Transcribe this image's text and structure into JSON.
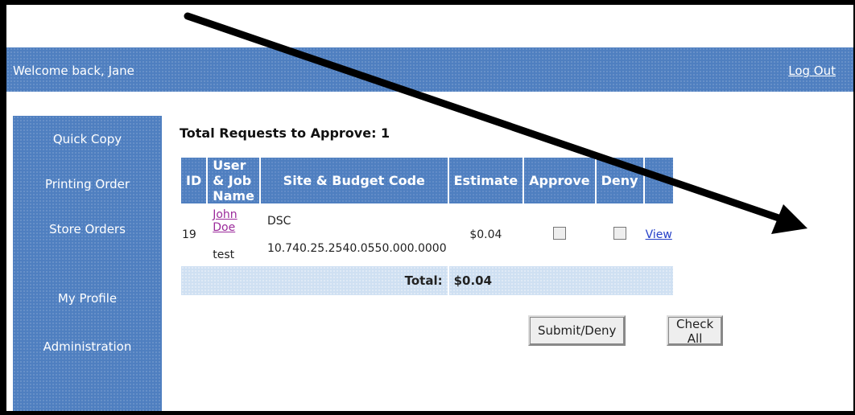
{
  "header": {
    "welcome": "Welcome back, Jane",
    "logout": "Log Out"
  },
  "sidebar": {
    "items": [
      {
        "label": "Quick Copy"
      },
      {
        "label": "Printing Order"
      },
      {
        "label": "Store Orders"
      },
      {
        "label": "My Profile"
      },
      {
        "label": "Administration"
      }
    ]
  },
  "main": {
    "total_requests": "Total Requests to Approve: 1",
    "columns": [
      "ID",
      "User & Job Name",
      "Site & Budget Code",
      "Estimate",
      "Approve",
      "Deny",
      ""
    ],
    "rows": [
      {
        "id": "19",
        "user": "John Doe",
        "job": "test",
        "site": "DSC",
        "budget_code": "10.740.25.2540.0550.000.0000",
        "estimate": "$0.04",
        "view": "View"
      }
    ],
    "total_label": "Total:",
    "total_value": "$0.04",
    "buttons": {
      "submit": "Submit/Deny",
      "check_all": "Check All"
    }
  }
}
